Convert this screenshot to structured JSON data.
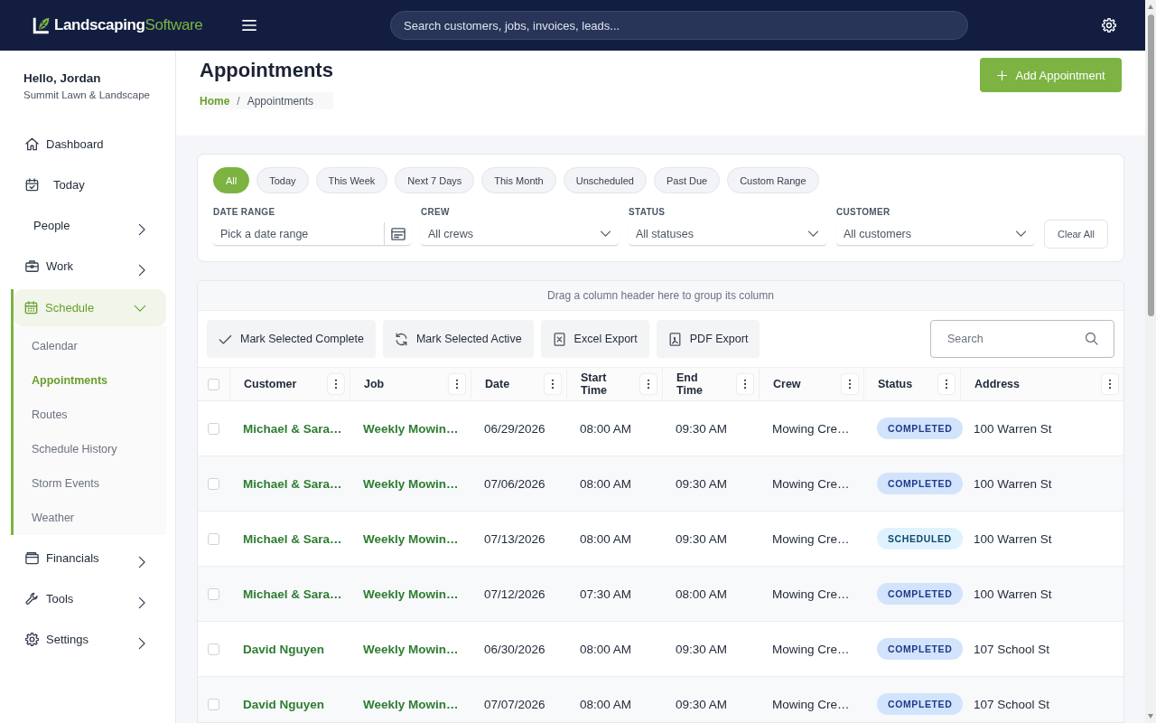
{
  "top_bar": {
    "logo": {
      "primary": "Landscaping",
      "secondary": "Software"
    },
    "search": {
      "placeholder": "Search customers, jobs, invoices, leads..."
    }
  },
  "sidebar": {
    "greeting": "Hello, Jordan",
    "company": "Summit Lawn & Landscape",
    "items": [
      {
        "label": "Dashboard",
        "selected": false
      },
      {
        "label": "Today",
        "selected": false
      },
      {
        "label": "People",
        "selected": false,
        "expanded": false
      },
      {
        "label": "Work",
        "selected": false,
        "expanded": false
      },
      {
        "label": "Schedule",
        "selected": true,
        "expanded": true,
        "children": [
          {
            "label": "Calendar",
            "selected": false
          },
          {
            "label": "Appointments",
            "selected": true
          },
          {
            "label": "Routes",
            "selected": false
          },
          {
            "label": "Schedule History",
            "selected": false
          },
          {
            "label": "Storm Events",
            "selected": false
          },
          {
            "label": "Weather",
            "selected": false
          }
        ]
      },
      {
        "label": "Financials",
        "selected": false,
        "expanded": false
      },
      {
        "label": "Tools",
        "selected": false,
        "expanded": false
      },
      {
        "label": "Settings",
        "selected": false,
        "expanded": false
      }
    ]
  },
  "page_header": {
    "title": "Appointments",
    "breadcrumb": {
      "separator": "/",
      "items": [
        {
          "label": "Home",
          "current": false
        },
        {
          "label": "Appointments",
          "current": true
        }
      ]
    },
    "add_button": "Add Appointment"
  },
  "quick_filters": [
    {
      "label": "All",
      "selected": true
    },
    {
      "label": "Today",
      "selected": false
    },
    {
      "label": "This Week",
      "selected": false
    },
    {
      "label": "Next 7 Days",
      "selected": false
    },
    {
      "label": "This Month",
      "selected": false
    },
    {
      "label": "Unscheduled",
      "selected": false
    },
    {
      "label": "Past Due",
      "selected": false
    },
    {
      "label": "Custom Range",
      "selected": false
    }
  ],
  "filters": [
    {
      "kind": "date",
      "label": "DATE RANGE",
      "placeholder": "Pick a date range"
    },
    {
      "kind": "select",
      "label": "CREW",
      "value": "All crews"
    },
    {
      "kind": "select",
      "label": "STATUS",
      "value": "All statuses"
    },
    {
      "kind": "select",
      "label": "CUSTOMER",
      "value": "All customers"
    }
  ],
  "clear_button": "Clear All",
  "grid": {
    "group_panel": "Drag a column header here to group its column",
    "toolbar": [
      "Mark Selected Complete",
      "Mark Selected Active",
      "Excel Export",
      "PDF Export"
    ],
    "search": {
      "placeholder": "Search"
    },
    "select_all": {
      "checked": false
    },
    "columns": [
      "Customer",
      "Job",
      "Date",
      "Start Time",
      "End Time",
      "Crew",
      "Status",
      "Address"
    ],
    "rows": [
      {
        "selected": false,
        "customer": "Michael & Sara…",
        "job": "Weekly Mowin…",
        "date": "06/29/2026",
        "start": "08:00 AM",
        "end": "09:30 AM",
        "crew": "Mowing Cre…",
        "status": {
          "kind": "completed",
          "text": "COMPLETED"
        },
        "address": "100 Warren St"
      },
      {
        "selected": false,
        "customer": "Michael & Sara…",
        "job": "Weekly Mowin…",
        "date": "07/06/2026",
        "start": "08:00 AM",
        "end": "09:30 AM",
        "crew": "Mowing Cre…",
        "status": {
          "kind": "completed",
          "text": "COMPLETED"
        },
        "address": "100 Warren St"
      },
      {
        "selected": false,
        "customer": "Michael & Sara…",
        "job": "Weekly Mowin…",
        "date": "07/13/2026",
        "start": "08:00 AM",
        "end": "09:30 AM",
        "crew": "Mowing Cre…",
        "status": {
          "kind": "scheduled",
          "text": "SCHEDULED"
        },
        "address": "100 Warren St"
      },
      {
        "selected": false,
        "customer": "Michael & Sara…",
        "job": "Weekly Mowin…",
        "date": "07/12/2026",
        "start": "07:30 AM",
        "end": "08:00 AM",
        "crew": "Mowing Cre…",
        "status": {
          "kind": "completed",
          "text": "COMPLETED"
        },
        "address": "100 Warren St"
      },
      {
        "selected": false,
        "customer": "David Nguyen",
        "job": "Weekly Mowin…",
        "date": "06/30/2026",
        "start": "08:00 AM",
        "end": "09:30 AM",
        "crew": "Mowing Cre…",
        "status": {
          "kind": "completed",
          "text": "COMPLETED"
        },
        "address": "107 School St"
      },
      {
        "selected": false,
        "customer": "David Nguyen",
        "job": "Weekly Mowin…",
        "date": "07/07/2026",
        "start": "08:00 AM",
        "end": "09:30 AM",
        "crew": "Mowing Cre…",
        "status": {
          "kind": "completed",
          "text": "COMPLETED"
        },
        "address": "107 School St"
      }
    ]
  }
}
